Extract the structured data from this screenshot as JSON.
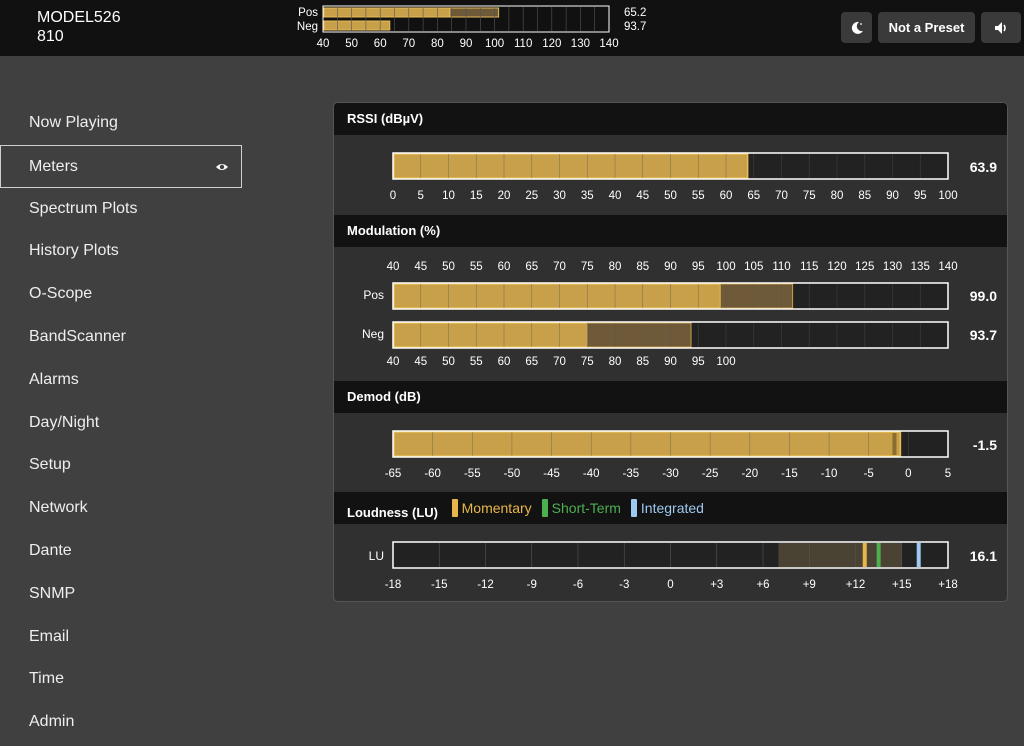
{
  "header": {
    "model": "MODEL526",
    "unit": "810",
    "mini": {
      "labels": [
        "Pos",
        "Neg"
      ],
      "values": [
        "65.2",
        "93.7"
      ],
      "ticks": [
        "40",
        "50",
        "60",
        "70",
        "80",
        "90",
        "100",
        "110",
        "120",
        "130",
        "140"
      ],
      "pos_fill_pct": 0.75,
      "pos_peak_pct": 0.44,
      "neg_fill_pct": 0.23
    },
    "preset_label": "Not a Preset",
    "moon_icon": "moon-icon",
    "speaker_icon": "speaker-icon"
  },
  "sidebar": {
    "items": [
      {
        "label": "Now Playing"
      },
      {
        "label": "Meters",
        "active": true
      },
      {
        "label": "Spectrum Plots"
      },
      {
        "label": "History Plots"
      },
      {
        "label": "O-Scope"
      },
      {
        "label": "BandScanner"
      },
      {
        "label": "Alarms"
      },
      {
        "label": "Day/Night"
      },
      {
        "label": "Setup"
      },
      {
        "label": "Network"
      },
      {
        "label": "Dante"
      },
      {
        "label": "SNMP"
      },
      {
        "label": "Email"
      },
      {
        "label": "Time"
      },
      {
        "label": "Admin"
      }
    ]
  },
  "colors": {
    "fill": "#c9a04a",
    "fill_border": "#e8bd55",
    "peak": "#6e5a38",
    "momentary": "#e8b64a",
    "short_term": "#4caf50",
    "integrated": "#9ec9f0",
    "loud_zone": "#4a4233"
  },
  "rssi": {
    "title": "RSSI (dBµV)",
    "value": "63.9",
    "level": 63.9,
    "min": 0,
    "max": 100,
    "ticks": [
      "0",
      "5",
      "10",
      "15",
      "20",
      "25",
      "30",
      "35",
      "40",
      "45",
      "50",
      "55",
      "60",
      "65",
      "70",
      "75",
      "80",
      "85",
      "90",
      "95",
      "100"
    ]
  },
  "modulation": {
    "title": "Modulation (%)",
    "ticks_top": [
      "40",
      "45",
      "50",
      "55",
      "60",
      "65",
      "70",
      "75",
      "80",
      "85",
      "90",
      "95",
      "100",
      "105",
      "110",
      "115",
      "120",
      "125",
      "130",
      "135",
      "140"
    ],
    "ticks_bottom": [
      "40",
      "45",
      "50",
      "55",
      "60",
      "65",
      "70",
      "75",
      "80",
      "85",
      "90",
      "95",
      "100"
    ],
    "pos": {
      "label": "Pos",
      "value": "99.0",
      "level": 99.0,
      "peak": 112,
      "min": 40,
      "max": 140
    },
    "neg": {
      "label": "Neg",
      "value": "93.7",
      "level": 75,
      "peak": 93.7,
      "min": 40,
      "max": 140
    }
  },
  "demod": {
    "title": "Demod (dB)",
    "value": "-1.5",
    "level": -1.5,
    "peak": -1.0,
    "min": -65,
    "max": 5,
    "ticks": [
      "-65",
      "-60",
      "-55",
      "-50",
      "-45",
      "-40",
      "-35",
      "-30",
      "-25",
      "-20",
      "-15",
      "-10",
      "-5",
      "0",
      "5"
    ]
  },
  "loudness": {
    "title": "Loudness (LU)",
    "legend": [
      {
        "label": "Momentary",
        "color": "#e8b64a"
      },
      {
        "label": "Short-Term",
        "color": "#4caf50"
      },
      {
        "label": "Integrated",
        "color": "#9ec9f0"
      }
    ],
    "label": "LU",
    "value": "16.1",
    "min": -18,
    "max": 18,
    "zone_start": 7,
    "zone_end": 15,
    "momentary": 12.6,
    "short_term": 13.5,
    "integrated": 16.1,
    "ticks": [
      "-18",
      "-15",
      "-12",
      "-9",
      "-6",
      "-3",
      "0",
      "+3",
      "+6",
      "+9",
      "+12",
      "+15",
      "+18"
    ]
  }
}
